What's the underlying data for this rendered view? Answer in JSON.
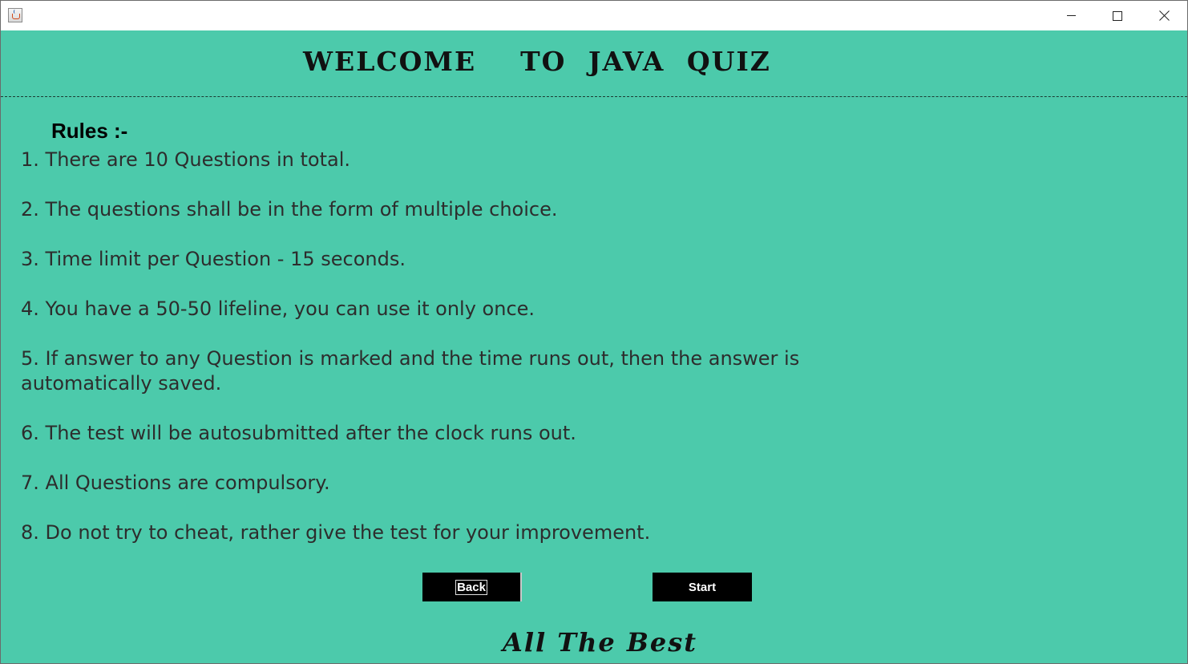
{
  "window": {
    "controls": {
      "minimize_icon": "minimize-icon",
      "maximize_icon": "maximize-icon",
      "close_icon": "close-icon"
    },
    "app_icon": "java-icon",
    "background_color": "#4ccaab"
  },
  "heading": "WELCOME  TO JAVA QUIZ",
  "rules": {
    "title": "Rules :-",
    "items": [
      "1. There are 10 Questions in total.",
      "2. The questions shall be in the form of multiple choice.",
      "3. Time limit per Question - 15 seconds.",
      "4. You have a 50-50 lifeline, you can use it only once.",
      "5. If answer to any Question is marked and the time runs out, then the answer is automatically saved.",
      "6. The test will be autosubmitted after the clock runs out.",
      "7. All Questions are compulsory.",
      "8. Do not try to cheat, rather give the test for your improvement."
    ]
  },
  "buttons": {
    "back_label": "Back",
    "start_label": "Start"
  },
  "footer": "All The Best"
}
